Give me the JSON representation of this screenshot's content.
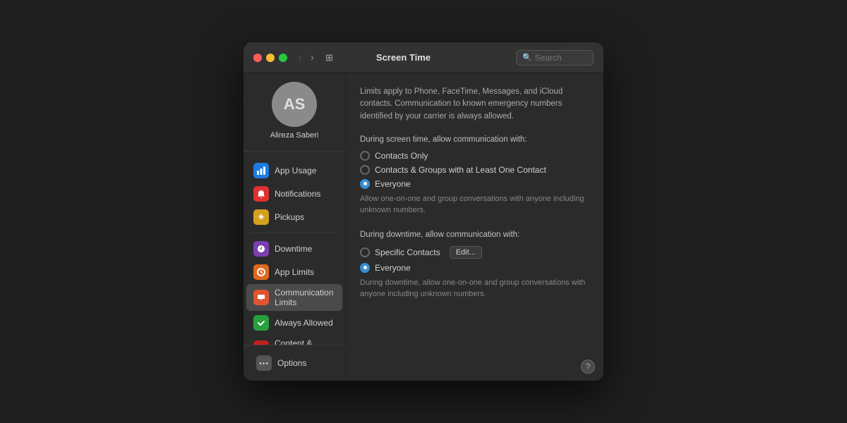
{
  "window": {
    "title": "Screen Time",
    "search_placeholder": "Search"
  },
  "titlebar": {
    "back_label": "‹",
    "forward_label": "›",
    "grid_label": "⊞"
  },
  "sidebar": {
    "avatar": {
      "initials": "AS",
      "name": "Alireza Saberi"
    },
    "nav_items": [
      {
        "id": "app-usage",
        "label": "App Usage",
        "icon": "📊",
        "icon_class": "icon-blue"
      },
      {
        "id": "notifications",
        "label": "Notifications",
        "icon": "🔔",
        "icon_class": "icon-red"
      },
      {
        "id": "pickups",
        "label": "Pickups",
        "icon": "⬆",
        "icon_class": "icon-yellow"
      },
      {
        "id": "downtime",
        "label": "Downtime",
        "icon": "🌙",
        "icon_class": "icon-purple"
      },
      {
        "id": "app-limits",
        "label": "App Limits",
        "icon": "⏱",
        "icon_class": "icon-orange"
      },
      {
        "id": "communication-limits",
        "label": "Communication Limits",
        "icon": "💬",
        "icon_class": "icon-orange-red",
        "active": true
      },
      {
        "id": "always-allowed",
        "label": "Always Allowed",
        "icon": "✓",
        "icon_class": "icon-green"
      },
      {
        "id": "content-privacy",
        "label": "Content & Privacy",
        "icon": "🔒",
        "icon_class": "icon-dark-red"
      }
    ],
    "options_label": "Options",
    "options_icon": "⋯"
  },
  "main": {
    "info_text": "Limits apply to Phone, FaceTime, Messages, and iCloud contacts. Communication to known emergency numbers identified by your carrier is always allowed.",
    "screen_time_section": {
      "label": "During screen time, allow communication with:",
      "options": [
        {
          "id": "contacts-only",
          "label": "Contacts Only",
          "selected": false
        },
        {
          "id": "contacts-groups",
          "label": "Contacts & Groups with at Least One Contact",
          "selected": false
        },
        {
          "id": "everyone",
          "label": "Everyone",
          "selected": true
        }
      ],
      "sub_text": "Allow one-on-one and group conversations with anyone including unknown numbers."
    },
    "downtime_section": {
      "label": "During downtime, allow communication with:",
      "options": [
        {
          "id": "specific-contacts",
          "label": "Specific Contacts",
          "selected": false,
          "has_edit": true
        },
        {
          "id": "everyone-down",
          "label": "Everyone",
          "selected": true
        }
      ],
      "edit_label": "Edit...",
      "sub_text": "During downtime, allow one-on-one and group conversations with anyone including unknown numbers."
    },
    "help_label": "?"
  }
}
